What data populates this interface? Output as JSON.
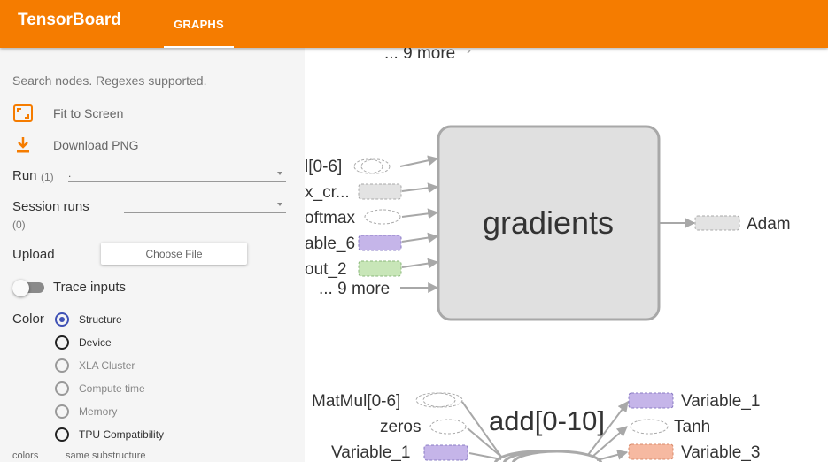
{
  "header": {
    "app_title": "TensorBoard",
    "active_tab": "GRAPHS"
  },
  "sidebar": {
    "search_placeholder": "Search nodes. Regexes supported.",
    "fit_label": "Fit to Screen",
    "download_label": "Download PNG",
    "run_label": "Run",
    "run_count": "(1)",
    "run_value": ".",
    "session_label": "Session runs",
    "session_count": "(0)",
    "upload_label": "Upload",
    "choose_file_label": "Choose File",
    "trace_label": "Trace inputs",
    "color_label": "Color",
    "color_options": [
      {
        "label": "Structure",
        "selected": true
      },
      {
        "label": "Device",
        "selected": false
      },
      {
        "label": "XLA Cluster",
        "selected": false
      },
      {
        "label": "Compute time",
        "selected": false
      },
      {
        "label": "Memory",
        "selected": false
      },
      {
        "label": "TPU Compatibility",
        "selected": false
      }
    ],
    "legend_colors": "colors",
    "legend_same": "same substructure"
  },
  "graph": {
    "top_more": "... 9 more",
    "main_node": "gradients",
    "inputs": [
      "l[0-6]",
      "x_cr...",
      "oftmax",
      "able_6",
      "out_2",
      "... 9 more"
    ],
    "output": "Adam",
    "lower_node": "add[0-10]",
    "lower_inputs": [
      "MatMul[0-6]",
      "zeros",
      "Variable_1"
    ],
    "lower_outputs": [
      "Variable_1",
      "Tanh",
      "Variable_3"
    ]
  },
  "colors": {
    "accent": "#f57c00",
    "radio_selected": "#3f51b5",
    "node_fill": "#e0e0e0",
    "node_stroke": "#a8a8a8",
    "purple": "#c5b5e9",
    "green": "#c8e6b8",
    "salmon": "#f6b9a1"
  },
  "icons": {
    "fit": "fit-screen-icon",
    "download": "download-icon"
  }
}
